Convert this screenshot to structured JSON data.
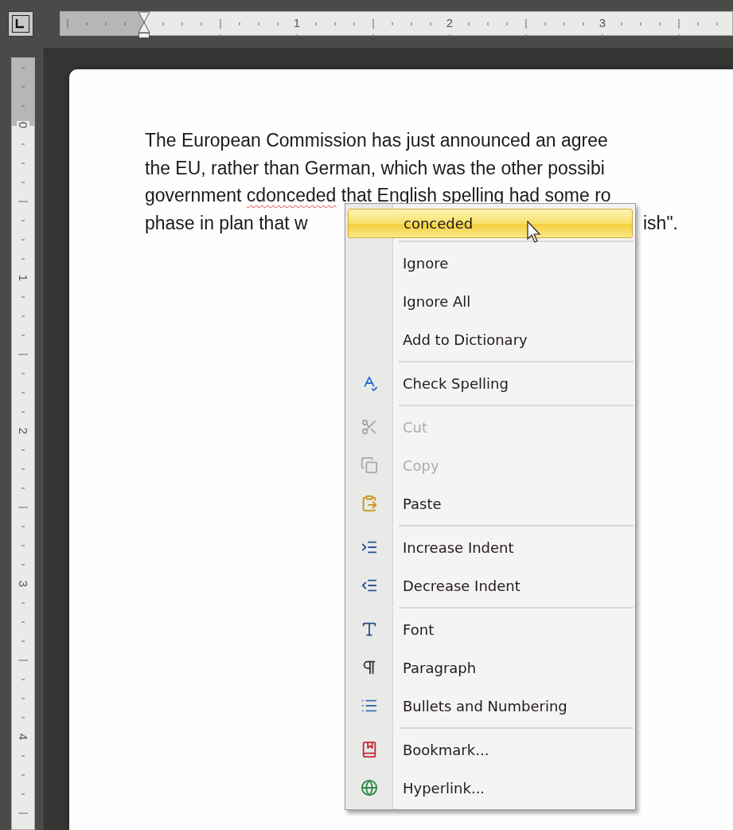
{
  "ruler": {
    "horizontal_numbers": [
      "1",
      "2",
      "3"
    ],
    "vertical_numbers": [
      "0",
      "1",
      "2",
      "3",
      "4"
    ]
  },
  "document": {
    "lines": [
      {
        "fragments": [
          [
            {
              "text": "The European Commission has just announced an agree",
              "misspelled": false
            }
          ]
        ]
      },
      {
        "fragments": [
          [
            {
              "text": "the EU, rather than German, which was the other possibi",
              "misspelled": false
            }
          ]
        ]
      },
      {
        "fragments": [
          [
            {
              "text": "government ",
              "misspelled": false
            },
            {
              "text": "cdonceded",
              "misspelled": true
            },
            {
              "text": " that English spelling had some ro",
              "misspelled": false
            }
          ]
        ]
      },
      {
        "fragments": [
          [
            {
              "text": "phase in plan that w",
              "misspelled": false
            }
          ],
          [
            {
              "text": "ish\".",
              "misspelled": false
            }
          ]
        ]
      }
    ]
  },
  "context_menu": {
    "suggestion": {
      "label": "conceded",
      "selected": true
    },
    "groups": [
      {
        "items": [
          {
            "label": "Ignore",
            "disabled": false
          },
          {
            "label": "Ignore All",
            "disabled": false
          },
          {
            "label": "Add to Dictionary",
            "disabled": false
          }
        ]
      },
      {
        "items": [
          {
            "label": "Check Spelling",
            "disabled": false
          }
        ]
      },
      {
        "items": [
          {
            "label": "Cut",
            "disabled": true
          },
          {
            "label": "Copy",
            "disabled": true
          },
          {
            "label": "Paste",
            "disabled": false
          }
        ]
      },
      {
        "items": [
          {
            "label": "Increase Indent",
            "disabled": false
          },
          {
            "label": "Decrease Indent",
            "disabled": false
          }
        ]
      },
      {
        "items": [
          {
            "label": "Font",
            "disabled": false
          },
          {
            "label": "Paragraph",
            "disabled": false
          },
          {
            "label": "Bullets and Numbering",
            "disabled": false
          }
        ]
      },
      {
        "items": [
          {
            "label": "Bookmark...",
            "disabled": false
          },
          {
            "label": "Hyperlink...",
            "disabled": false
          }
        ]
      }
    ]
  }
}
